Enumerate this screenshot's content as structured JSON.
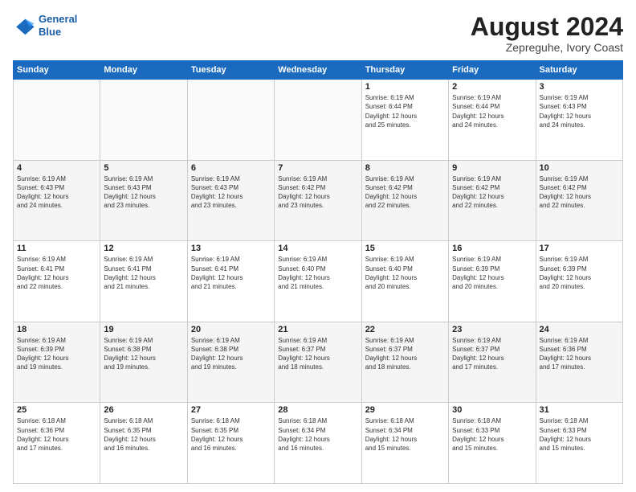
{
  "header": {
    "logo_line1": "General",
    "logo_line2": "Blue",
    "main_title": "August 2024",
    "subtitle": "Zepreguhe, Ivory Coast"
  },
  "days_of_week": [
    "Sunday",
    "Monday",
    "Tuesday",
    "Wednesday",
    "Thursday",
    "Friday",
    "Saturday"
  ],
  "weeks": [
    [
      {
        "day": "",
        "info": ""
      },
      {
        "day": "",
        "info": ""
      },
      {
        "day": "",
        "info": ""
      },
      {
        "day": "",
        "info": ""
      },
      {
        "day": "1",
        "info": "Sunrise: 6:19 AM\nSunset: 6:44 PM\nDaylight: 12 hours\nand 25 minutes."
      },
      {
        "day": "2",
        "info": "Sunrise: 6:19 AM\nSunset: 6:44 PM\nDaylight: 12 hours\nand 24 minutes."
      },
      {
        "day": "3",
        "info": "Sunrise: 6:19 AM\nSunset: 6:43 PM\nDaylight: 12 hours\nand 24 minutes."
      }
    ],
    [
      {
        "day": "4",
        "info": "Sunrise: 6:19 AM\nSunset: 6:43 PM\nDaylight: 12 hours\nand 24 minutes."
      },
      {
        "day": "5",
        "info": "Sunrise: 6:19 AM\nSunset: 6:43 PM\nDaylight: 12 hours\nand 23 minutes."
      },
      {
        "day": "6",
        "info": "Sunrise: 6:19 AM\nSunset: 6:43 PM\nDaylight: 12 hours\nand 23 minutes."
      },
      {
        "day": "7",
        "info": "Sunrise: 6:19 AM\nSunset: 6:42 PM\nDaylight: 12 hours\nand 23 minutes."
      },
      {
        "day": "8",
        "info": "Sunrise: 6:19 AM\nSunset: 6:42 PM\nDaylight: 12 hours\nand 22 minutes."
      },
      {
        "day": "9",
        "info": "Sunrise: 6:19 AM\nSunset: 6:42 PM\nDaylight: 12 hours\nand 22 minutes."
      },
      {
        "day": "10",
        "info": "Sunrise: 6:19 AM\nSunset: 6:42 PM\nDaylight: 12 hours\nand 22 minutes."
      }
    ],
    [
      {
        "day": "11",
        "info": "Sunrise: 6:19 AM\nSunset: 6:41 PM\nDaylight: 12 hours\nand 22 minutes."
      },
      {
        "day": "12",
        "info": "Sunrise: 6:19 AM\nSunset: 6:41 PM\nDaylight: 12 hours\nand 21 minutes."
      },
      {
        "day": "13",
        "info": "Sunrise: 6:19 AM\nSunset: 6:41 PM\nDaylight: 12 hours\nand 21 minutes."
      },
      {
        "day": "14",
        "info": "Sunrise: 6:19 AM\nSunset: 6:40 PM\nDaylight: 12 hours\nand 21 minutes."
      },
      {
        "day": "15",
        "info": "Sunrise: 6:19 AM\nSunset: 6:40 PM\nDaylight: 12 hours\nand 20 minutes."
      },
      {
        "day": "16",
        "info": "Sunrise: 6:19 AM\nSunset: 6:39 PM\nDaylight: 12 hours\nand 20 minutes."
      },
      {
        "day": "17",
        "info": "Sunrise: 6:19 AM\nSunset: 6:39 PM\nDaylight: 12 hours\nand 20 minutes."
      }
    ],
    [
      {
        "day": "18",
        "info": "Sunrise: 6:19 AM\nSunset: 6:39 PM\nDaylight: 12 hours\nand 19 minutes."
      },
      {
        "day": "19",
        "info": "Sunrise: 6:19 AM\nSunset: 6:38 PM\nDaylight: 12 hours\nand 19 minutes."
      },
      {
        "day": "20",
        "info": "Sunrise: 6:19 AM\nSunset: 6:38 PM\nDaylight: 12 hours\nand 19 minutes."
      },
      {
        "day": "21",
        "info": "Sunrise: 6:19 AM\nSunset: 6:37 PM\nDaylight: 12 hours\nand 18 minutes."
      },
      {
        "day": "22",
        "info": "Sunrise: 6:19 AM\nSunset: 6:37 PM\nDaylight: 12 hours\nand 18 minutes."
      },
      {
        "day": "23",
        "info": "Sunrise: 6:19 AM\nSunset: 6:37 PM\nDaylight: 12 hours\nand 17 minutes."
      },
      {
        "day": "24",
        "info": "Sunrise: 6:19 AM\nSunset: 6:36 PM\nDaylight: 12 hours\nand 17 minutes."
      }
    ],
    [
      {
        "day": "25",
        "info": "Sunrise: 6:18 AM\nSunset: 6:36 PM\nDaylight: 12 hours\nand 17 minutes."
      },
      {
        "day": "26",
        "info": "Sunrise: 6:18 AM\nSunset: 6:35 PM\nDaylight: 12 hours\nand 16 minutes."
      },
      {
        "day": "27",
        "info": "Sunrise: 6:18 AM\nSunset: 6:35 PM\nDaylight: 12 hours\nand 16 minutes."
      },
      {
        "day": "28",
        "info": "Sunrise: 6:18 AM\nSunset: 6:34 PM\nDaylight: 12 hours\nand 16 minutes."
      },
      {
        "day": "29",
        "info": "Sunrise: 6:18 AM\nSunset: 6:34 PM\nDaylight: 12 hours\nand 15 minutes."
      },
      {
        "day": "30",
        "info": "Sunrise: 6:18 AM\nSunset: 6:33 PM\nDaylight: 12 hours\nand 15 minutes."
      },
      {
        "day": "31",
        "info": "Sunrise: 6:18 AM\nSunset: 6:33 PM\nDaylight: 12 hours\nand 15 minutes."
      }
    ]
  ]
}
